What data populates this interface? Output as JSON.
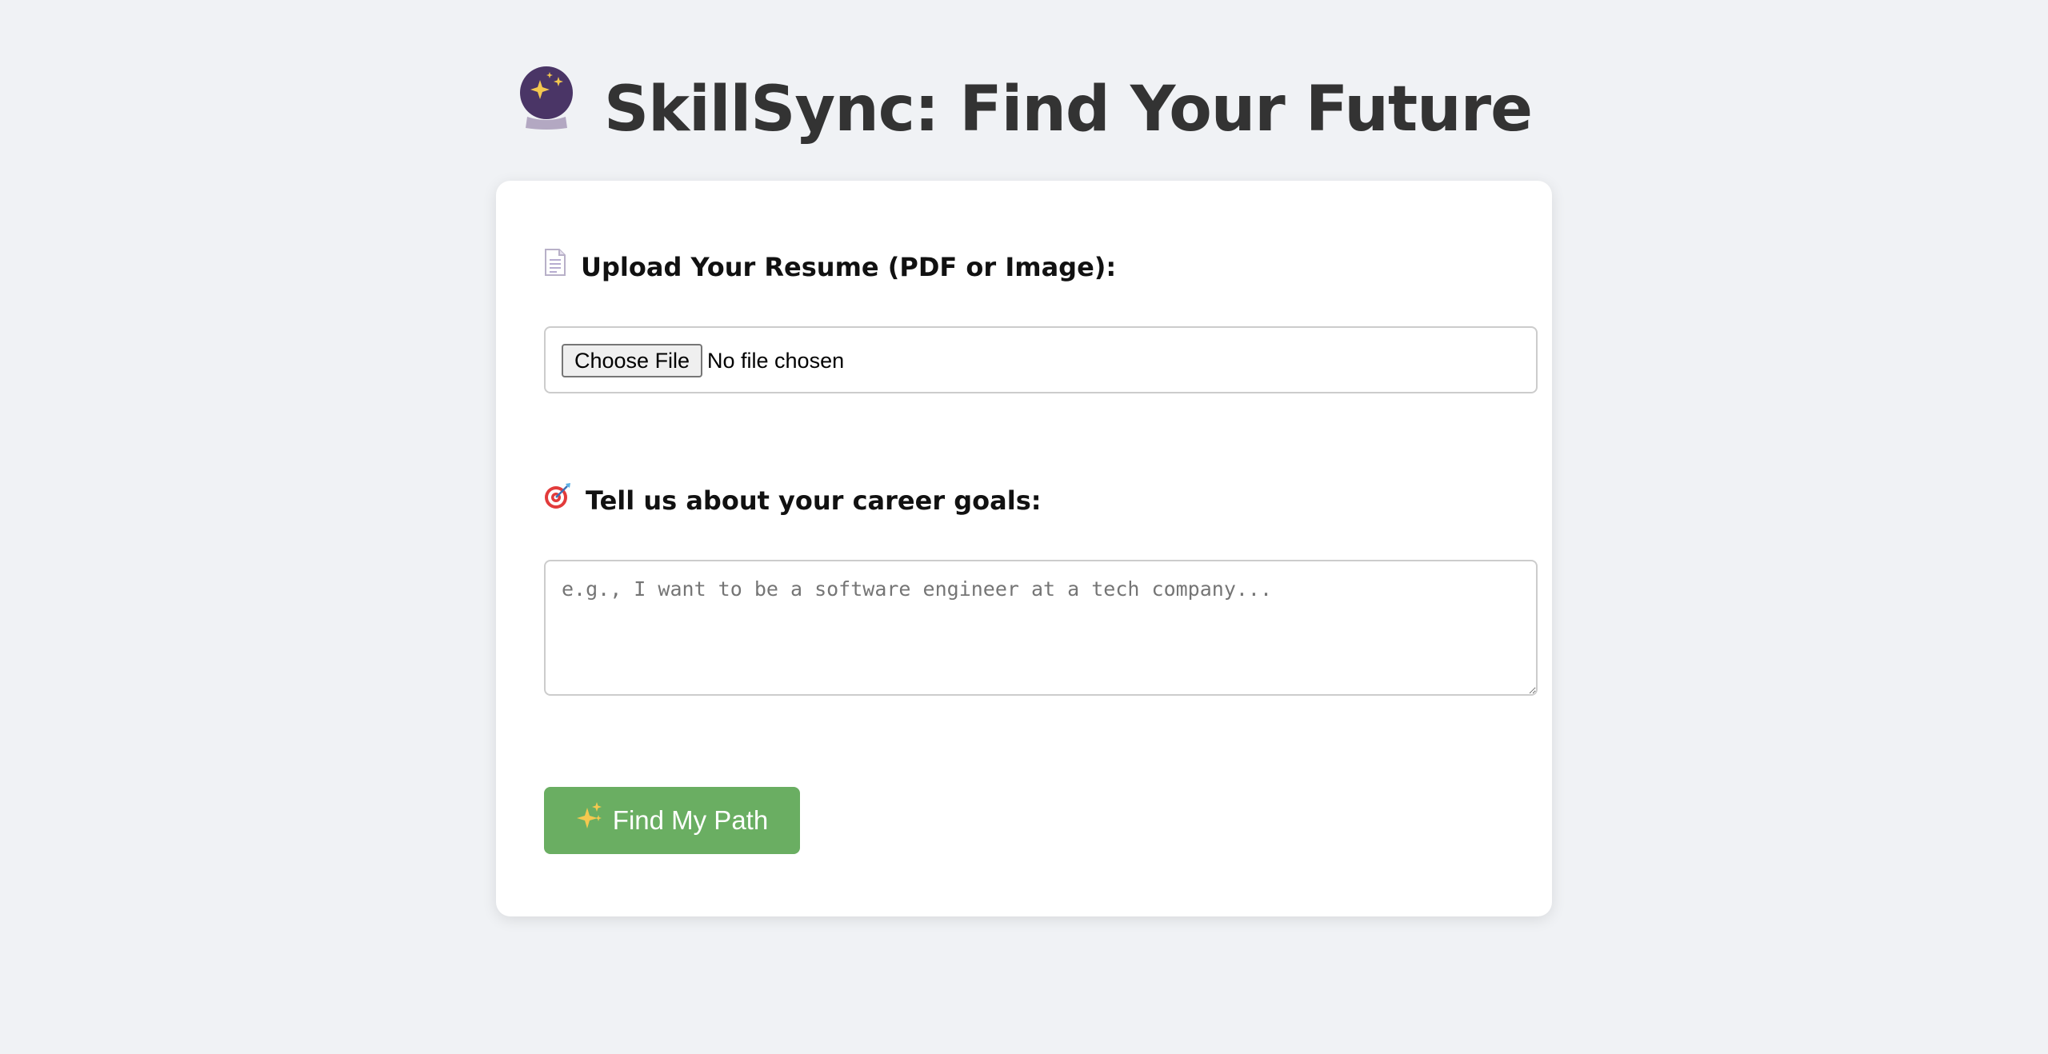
{
  "header": {
    "title": "SkillSync: Find Your Future",
    "icon": "crystal-ball-icon"
  },
  "form": {
    "resume": {
      "label": "Upload Your Resume (PDF or Image):",
      "icon": "page-document-icon",
      "choose_button_label": "Choose File",
      "file_status": "No file chosen"
    },
    "goals": {
      "label": "Tell us about your career goals:",
      "icon": "target-icon",
      "placeholder": "e.g., I want to be a software engineer at a tech company...",
      "value": ""
    },
    "submit": {
      "label": "Find My Path",
      "icon": "sparkles-icon",
      "color": "#6aae62"
    }
  },
  "colors": {
    "background": "#f0f2f5",
    "card": "#ffffff",
    "title_text": "#333333"
  }
}
